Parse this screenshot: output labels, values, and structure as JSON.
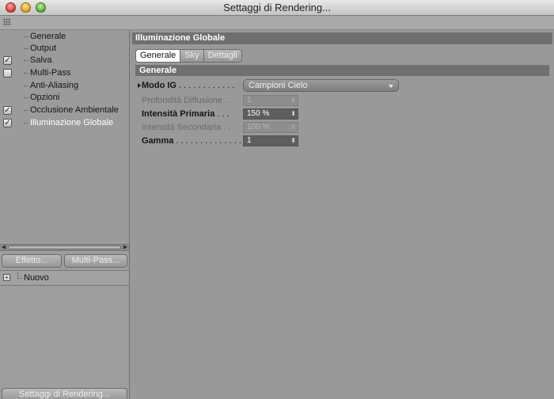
{
  "window": {
    "title": "Settaggi di Rendering..."
  },
  "sidebar": {
    "items": [
      {
        "label": "Generale",
        "checkbox": "none",
        "selected": false
      },
      {
        "label": "Output",
        "checkbox": "none",
        "selected": false
      },
      {
        "label": "Salva",
        "checkbox": "checked",
        "selected": false
      },
      {
        "label": "Multi-Pass",
        "checkbox": "unchecked",
        "selected": false
      },
      {
        "label": "Anti-Aliasing",
        "checkbox": "none",
        "selected": false
      },
      {
        "label": "Opzioni",
        "checkbox": "none",
        "selected": false
      },
      {
        "label": "Occlusione Ambientale",
        "checkbox": "checked",
        "selected": false
      },
      {
        "label": "Illuminazione Globale",
        "checkbox": "checked",
        "selected": true
      }
    ],
    "effect_button": "Effetto...",
    "multipass_button": "Multi-Pass...",
    "effect_list": [
      {
        "label": "Nuovo"
      }
    ],
    "render_settings_button": "Settaggi di Rendering..."
  },
  "main": {
    "section_title": "Illuminazione Globale",
    "tabs": [
      {
        "label": "Generale",
        "active": true
      },
      {
        "label": "Sky",
        "active": false
      },
      {
        "label": "Dettagli",
        "active": false
      }
    ],
    "group_title": "Generale",
    "fields": {
      "mode": {
        "label": "Modo IG",
        "dots": " . . . . . . . . . . . .",
        "value": "Campioni Cielo"
      },
      "depth": {
        "label": "Profondità Diffusione",
        "dots": " . .",
        "value": "1"
      },
      "primary": {
        "label": "Intensità Primaria",
        "dots": " . . .",
        "value": "150 %"
      },
      "secondary": {
        "label": "Intensità Secondaria",
        "dots": " . . .",
        "value": "100 %"
      },
      "gamma": {
        "label": "Gamma",
        "dots": " . . . . . . . . . . . . . . .",
        "value": "1"
      }
    }
  }
}
